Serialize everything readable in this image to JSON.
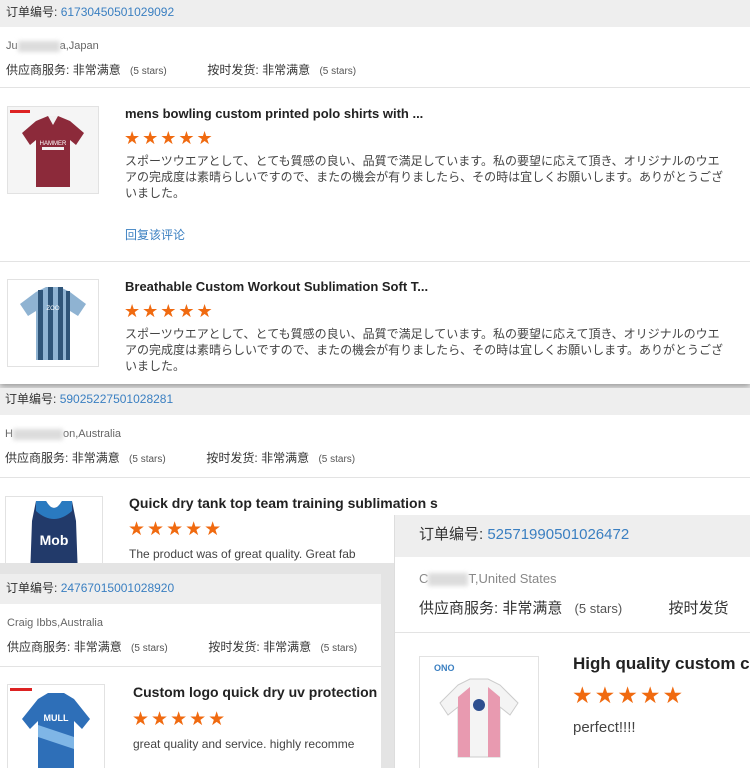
{
  "order_label": "订单编号:",
  "supplier_service_label": "供应商服务:",
  "supplier_rating": "非常满意",
  "ontime_label": "按时发货:",
  "ontime_rating": "非常满意",
  "five_stars": "(5 stars)",
  "star_glyphs": "★★★★★",
  "reply_link": "回复该评论",
  "orders": [
    {
      "number": "61730450501029092",
      "buyer_prefix": "Ju",
      "buyer_suffix": "a,Japan",
      "items": [
        {
          "title": "mens bowling custom printed polo shirts with ...",
          "review": "スポーツウエアとして、とても質感の良い、品質で満足しています。私の要望に応えて頂き、オリジナルのウエアの完成度は素晴らしいですので、またの機会が有りましたら、その時は宜しくお願いします。ありがとうございました。"
        },
        {
          "title": "Breathable Custom Workout Sublimation Soft T...",
          "review": "スポーツウエアとして、とても質感の良い、品質で満足しています。私の要望に応えて頂き、オリジナルのウエアの完成度は素晴らしいですので、またの機会が有りましたら、その時は宜しくお願いします。ありがとうございました。"
        }
      ]
    },
    {
      "number": "59025227501028281",
      "buyer_prefix": "H",
      "buyer_suffix": "on,Australia",
      "items": [
        {
          "title": "Quick dry tank top team training sublimation s",
          "review": "The product was of great quality. Great fab"
        }
      ]
    },
    {
      "number": "24767015001028920",
      "buyer": "Craig Ibbs,Australia",
      "items": [
        {
          "title": "Custom logo quick dry uv protection",
          "review": "great quality and service. highly recomme"
        }
      ]
    },
    {
      "number": "52571990501026472",
      "buyer_prefix": "C",
      "buyer_suffix": "T,United States",
      "ontime_label_short": "按时发货",
      "items": [
        {
          "title": "High quality custom c",
          "review": "perfect!!!!"
        }
      ]
    }
  ],
  "thumb_text": {
    "polo_logo": "HAMMER",
    "tank_logo": "Mob",
    "uv_logo": "MULL",
    "white_tag": "ONO"
  },
  "colors": {
    "link": "#3a7fc1",
    "star": "#f06a10",
    "bar": "#eeeeee"
  }
}
